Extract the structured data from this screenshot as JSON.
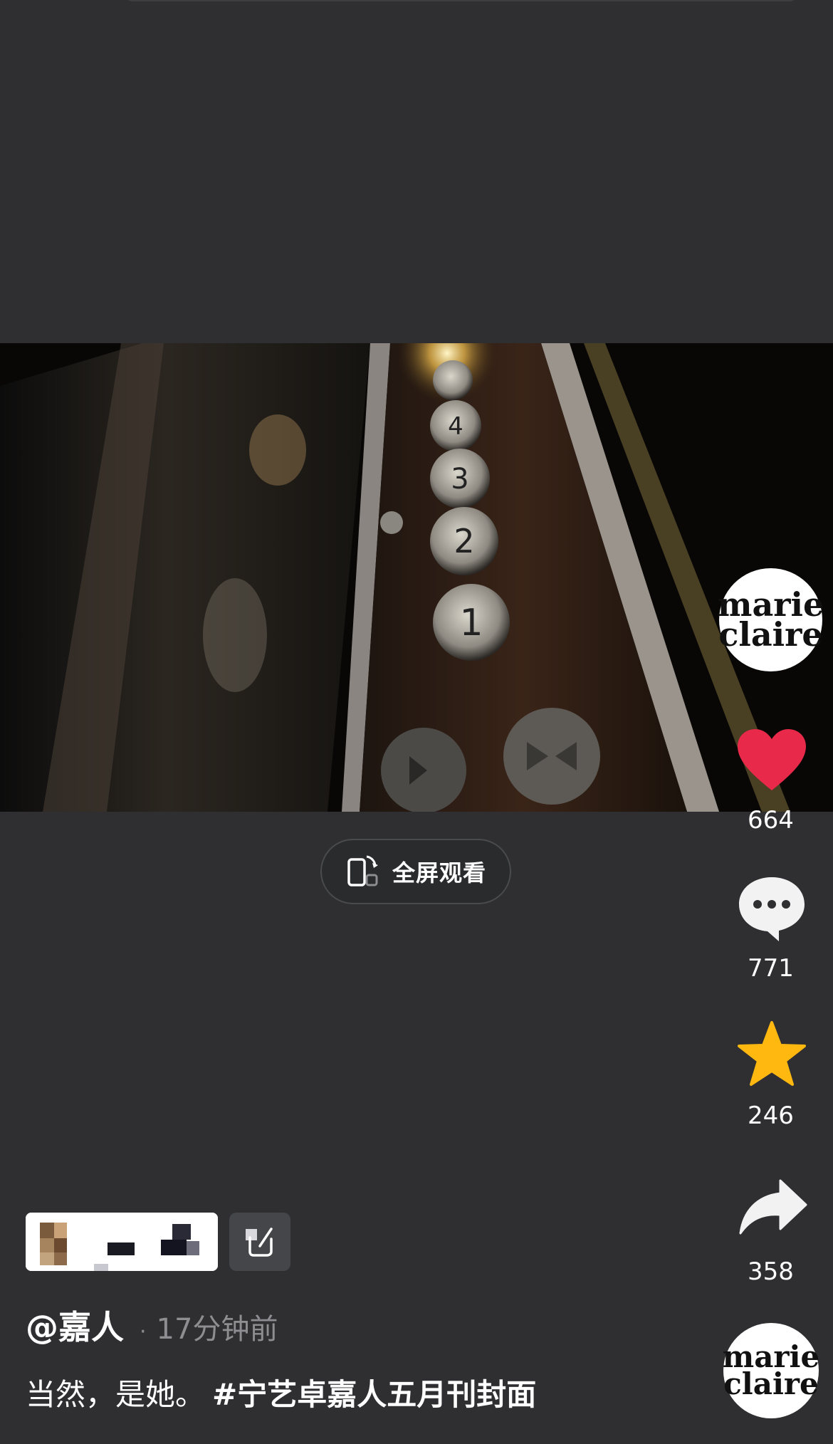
{
  "right_rail": {
    "brand_logo": {
      "line1": "marie",
      "line2": "claire"
    },
    "like": {
      "icon": "heart-icon",
      "count": "664",
      "color": "#e8294a"
    },
    "comment": {
      "icon": "comment-icon",
      "count": "771"
    },
    "favorite": {
      "icon": "star-icon",
      "count": "246",
      "color": "#ffb80f"
    },
    "share": {
      "icon": "share-icon",
      "count": "358"
    },
    "music_disc": {
      "line1": "marie",
      "line2": "claire"
    }
  },
  "fullscreen_button": {
    "label": "全屏观看",
    "icon": "rotate-phone-icon"
  },
  "video": {
    "buttons": [
      "4",
      "3",
      "2",
      "1"
    ]
  },
  "post": {
    "author": "@嘉人",
    "separator": "·",
    "time": "17分钟前",
    "caption_text": "当然，是她。",
    "caption_tag": "#宁艺卓嘉人五月刊封面",
    "edit_icon": "edit-icon"
  }
}
